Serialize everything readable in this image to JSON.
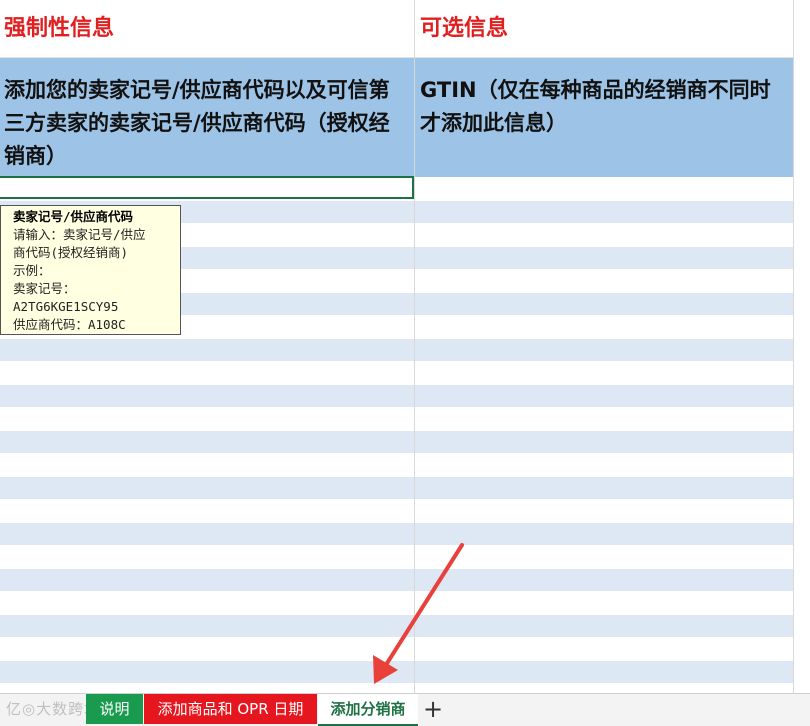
{
  "headers": {
    "mandatory": "强制性信息",
    "optional": "可选信息"
  },
  "descriptions": {
    "mandatory": "添加您的卖家记号/供应商代码以及可信第三方卖家的卖家记号/供应商代码（授权经销商）",
    "optional": "GTIN（仅在每种商品的经销商不同时才添加此信息）"
  },
  "comment": {
    "title": "卖家记号/供应商代码",
    "lines": [
      "请输入：卖家记号/供应",
      "商代码(授权经销商)",
      "示例：",
      "卖家记号：",
      "A2TG6KGE1SCY95",
      "供应商代码：A108C"
    ]
  },
  "tabs": [
    {
      "label": "说明",
      "color": "#1a9a4e"
    },
    {
      "label": "添加商品和 OPR 日期",
      "color": "#e5161e"
    },
    {
      "label": "添加分销商",
      "color": "#ffffff",
      "active": true
    }
  ],
  "add_tab_label": "+",
  "watermark": "亿◎大数跨境",
  "colors": {
    "header_text": "#e02020",
    "description_fill": "#9dc3e6",
    "band_fill": "#dde8f4",
    "selection_border": "#1e7145",
    "arrow": "#e8403a"
  }
}
